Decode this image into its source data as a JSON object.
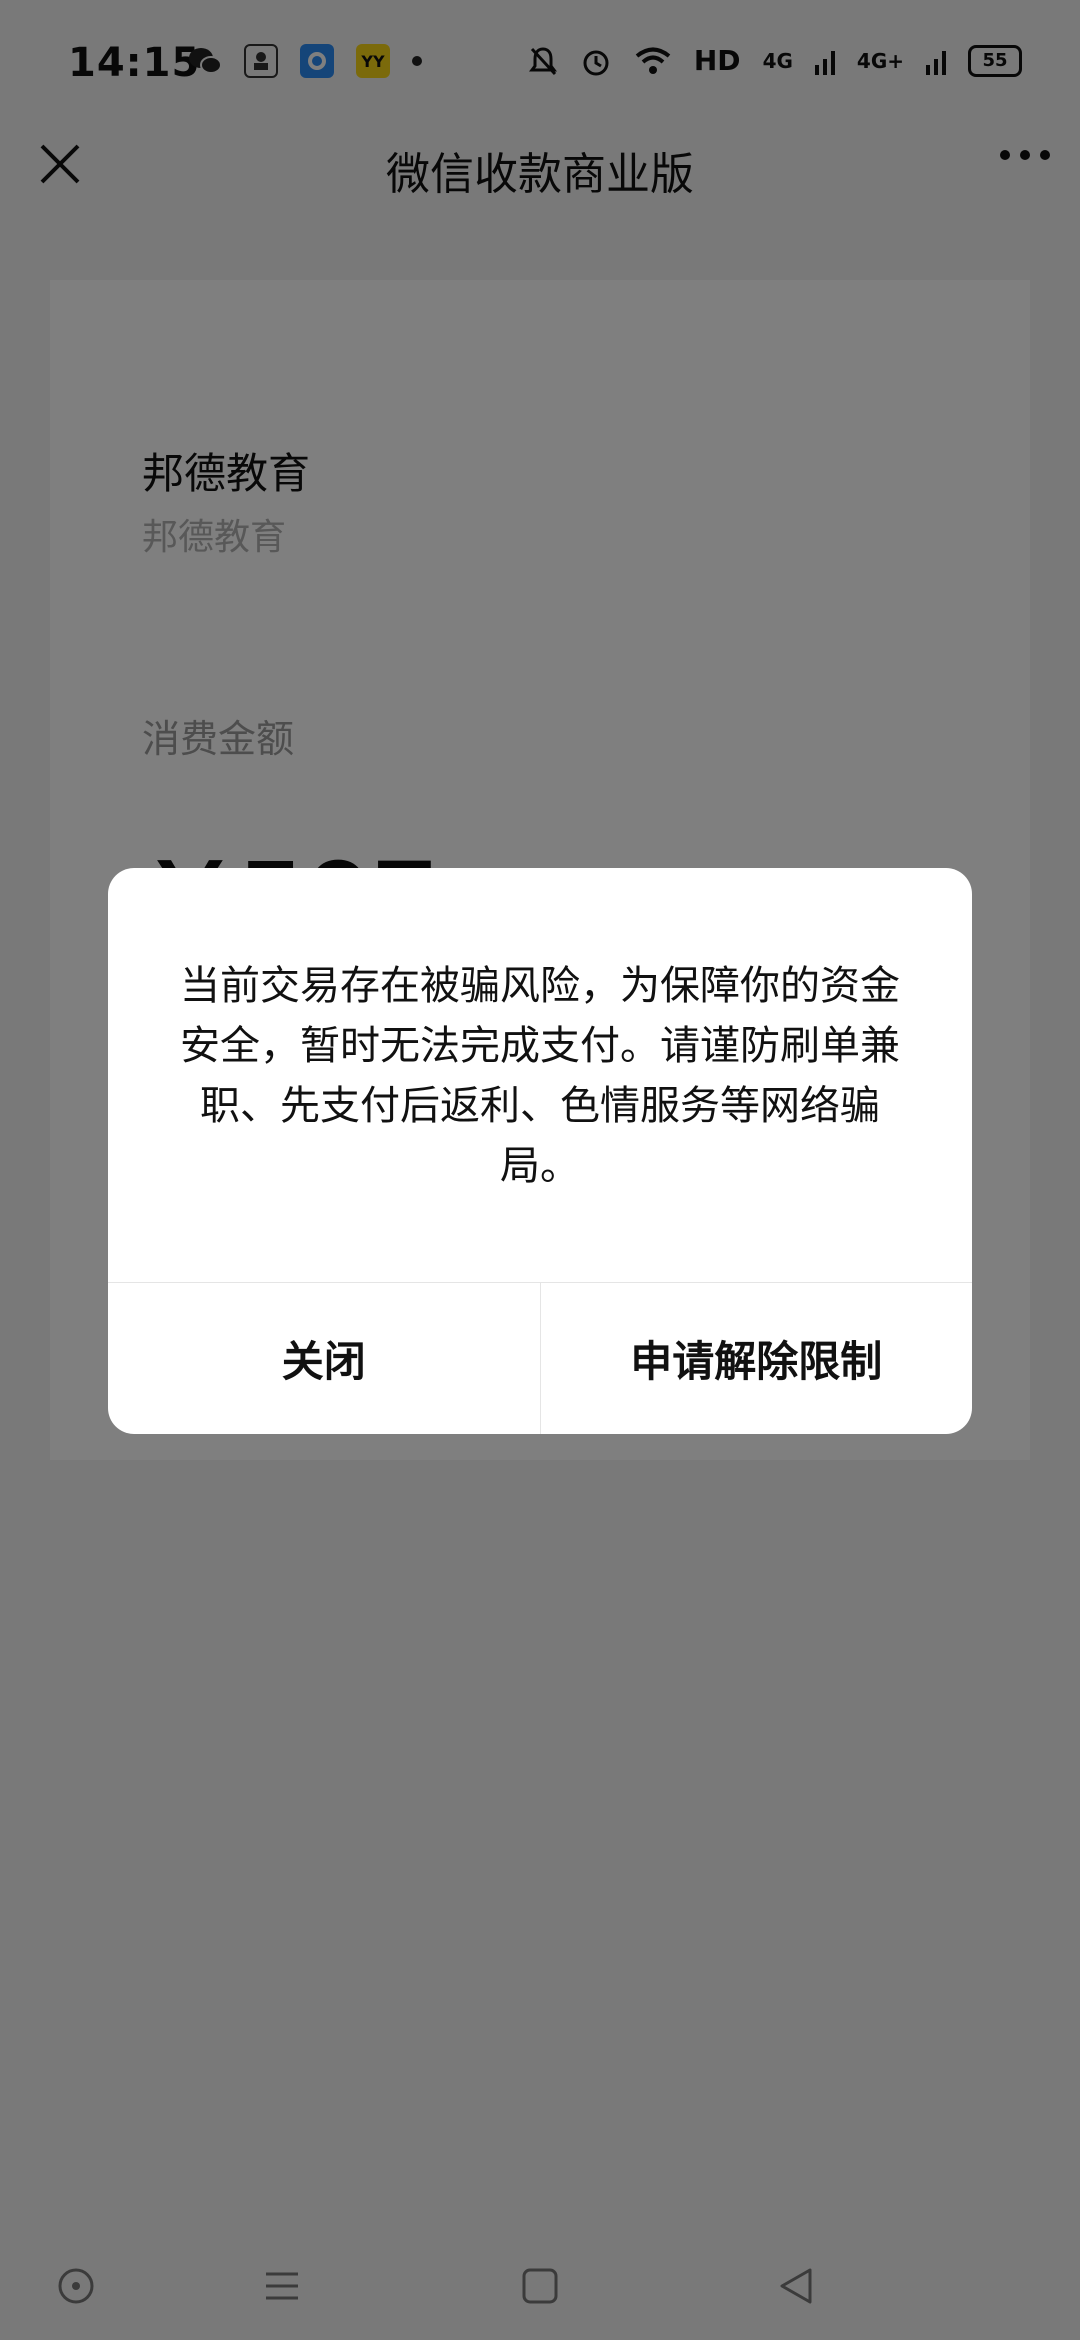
{
  "status_bar": {
    "time": "14:15",
    "network_label": "HD",
    "signal1": "4G",
    "signal2": "4G+",
    "battery": "55"
  },
  "nav": {
    "title": "微信收款商业版"
  },
  "card": {
    "merchant_name": "邦德教育",
    "merchant_sub": "邦德教育",
    "amount_label": "消费金额",
    "amount": "￥507"
  },
  "dialog": {
    "message": "当前交易存在被骗风险，为保障你的资金安全，暂时无法完成支付。请谨防刷单兼职、先支付后返利、色情服务等网络骗局。",
    "close_label": "关闭",
    "appeal_label": "申请解除限制"
  }
}
